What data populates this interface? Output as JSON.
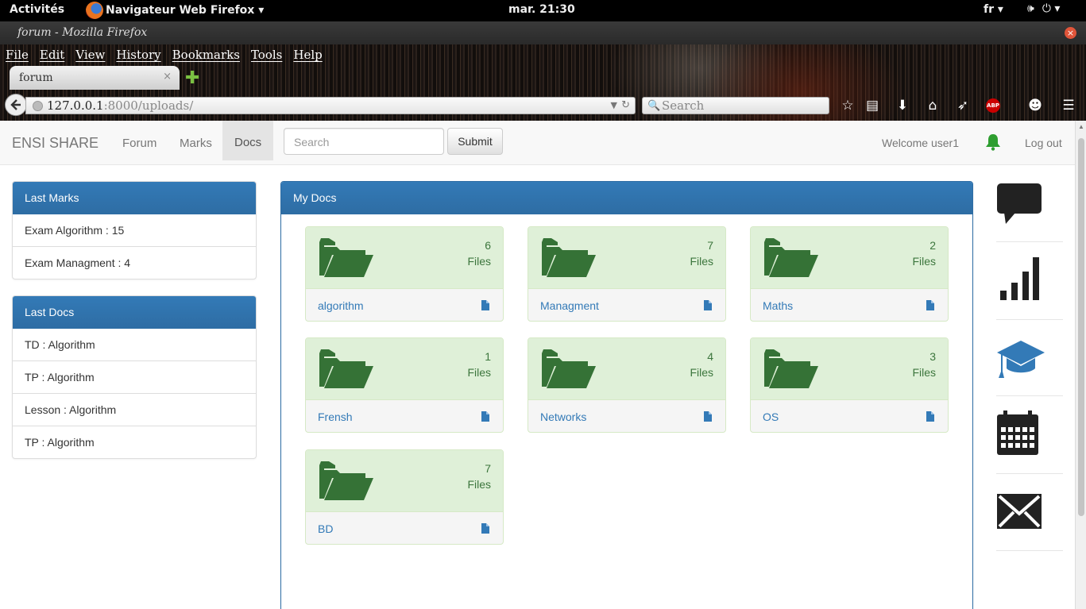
{
  "system": {
    "activities": "Activités",
    "app_name": "Navigateur Web Firefox ▾",
    "clock": "mar. 21:30",
    "lang": "fr ▾",
    "volume_icon": "🕪",
    "power_icon": "⏻ ▾"
  },
  "window": {
    "title": "forum - Mozilla Firefox",
    "close": "×"
  },
  "browser": {
    "menus": [
      "File",
      "Edit",
      "View",
      "History",
      "Bookmarks",
      "Tools",
      "Help"
    ],
    "tab_label": "forum",
    "tab_close": "×",
    "new_tab": "✚",
    "url_host": "127.0.0.1",
    "url_rest": ":8000/uploads/",
    "search_placeholder": "Search",
    "abp": "ABP"
  },
  "site": {
    "brand": "ENSI SHARE",
    "nav": [
      "Forum",
      "Marks",
      "Docs"
    ],
    "active_nav": "Docs",
    "search_placeholder": "Search",
    "submit": "Submit",
    "welcome": "Welcome user1",
    "logout": "Log out",
    "accent": "#337ab7",
    "folder_color": "#357236",
    "bell_color": "#2e9e30"
  },
  "last_marks": {
    "title": "Last Marks",
    "items": [
      "Exam Algorithm : 15",
      "Exam Managment : 4"
    ]
  },
  "last_docs": {
    "title": "Last Docs",
    "items": [
      "TD : Algorithm",
      "TP : Algorithm",
      "Lesson : Algorithm",
      "TP : Algorithm"
    ]
  },
  "my_docs": {
    "title": "My Docs",
    "folders": [
      {
        "name": "algorithm",
        "count": "6",
        "unit": "Files"
      },
      {
        "name": "Managment",
        "count": "7",
        "unit": "Files"
      },
      {
        "name": "Maths",
        "count": "2",
        "unit": "Files"
      },
      {
        "name": "Frensh",
        "count": "1",
        "unit": "Files"
      },
      {
        "name": "Networks",
        "count": "4",
        "unit": "Files"
      },
      {
        "name": "OS",
        "count": "3",
        "unit": "Files"
      },
      {
        "name": "BD",
        "count": "7",
        "unit": "Files"
      }
    ]
  },
  "sidebar_icons": [
    "comment-icon",
    "stats-icon",
    "graduation-cap-icon",
    "calendar-icon",
    "envelope-icon"
  ]
}
